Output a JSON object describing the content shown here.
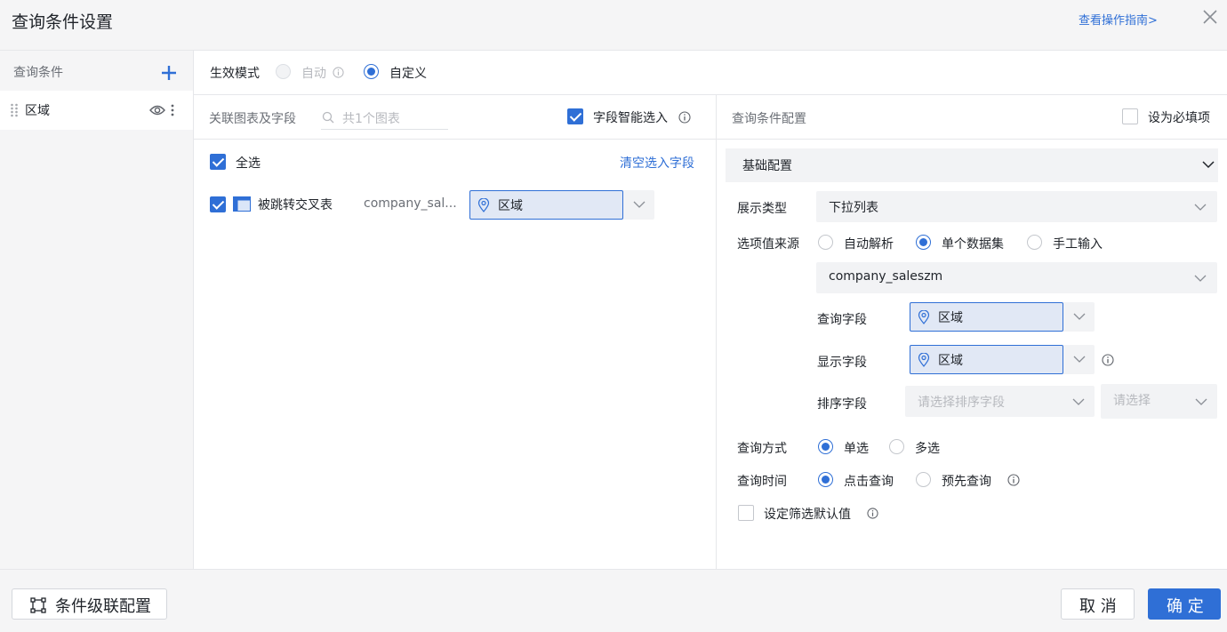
{
  "header": {
    "title": "查询条件设置",
    "guide_link": "查看操作指南>"
  },
  "sidebar": {
    "heading": "查询条件",
    "items": [
      {
        "label": "区域"
      }
    ]
  },
  "mode": {
    "label": "生效模式",
    "options": [
      {
        "label": "自动",
        "state": "disabled"
      },
      {
        "label": "自定义",
        "state": "selected"
      }
    ]
  },
  "linked": {
    "label": "关联图表及字段",
    "search_placeholder": "共1个图表",
    "smart_select_label": "字段智能选入",
    "smart_select_checked": true,
    "select_all_label": "全选",
    "clear_link": "清空选入字段",
    "rows": [
      {
        "chart_name": "被跳转交叉表",
        "dataset": "company_sal...",
        "field": "区域",
        "checked": true
      }
    ]
  },
  "config": {
    "label": "查询条件配置",
    "required_label": "设为必填项",
    "section_title": "基础配置",
    "display_type_label": "展示类型",
    "display_type_value": "下拉列表",
    "source_label": "选项值来源",
    "source_options": [
      "自动解析",
      "单个数据集",
      "手工输入"
    ],
    "source_selected": "单个数据集",
    "dataset_value": "company_saleszm",
    "query_field_label": "查询字段",
    "query_field_value": "区域",
    "display_field_label": "显示字段",
    "display_field_value": "区域",
    "sort_field_label": "排序字段",
    "sort_field_placeholder": "请选择排序字段",
    "sort_order_placeholder": "请选择",
    "query_mode_label": "查询方式",
    "query_mode_options": [
      "单选",
      "多选"
    ],
    "query_mode_selected": "单选",
    "query_time_label": "查询时间",
    "query_time_options": [
      "点击查询",
      "预先查询"
    ],
    "query_time_selected": "点击查询",
    "default_filter_label": "设定筛选默认值"
  },
  "footer": {
    "cascade_button": "条件级联配置",
    "cancel_button": "取 消",
    "confirm_button": "确 定"
  },
  "colors": {
    "accent": "#2f6fd6",
    "panel_bg": "#f5f5f6",
    "chip_bg": "#e1e8f5"
  }
}
